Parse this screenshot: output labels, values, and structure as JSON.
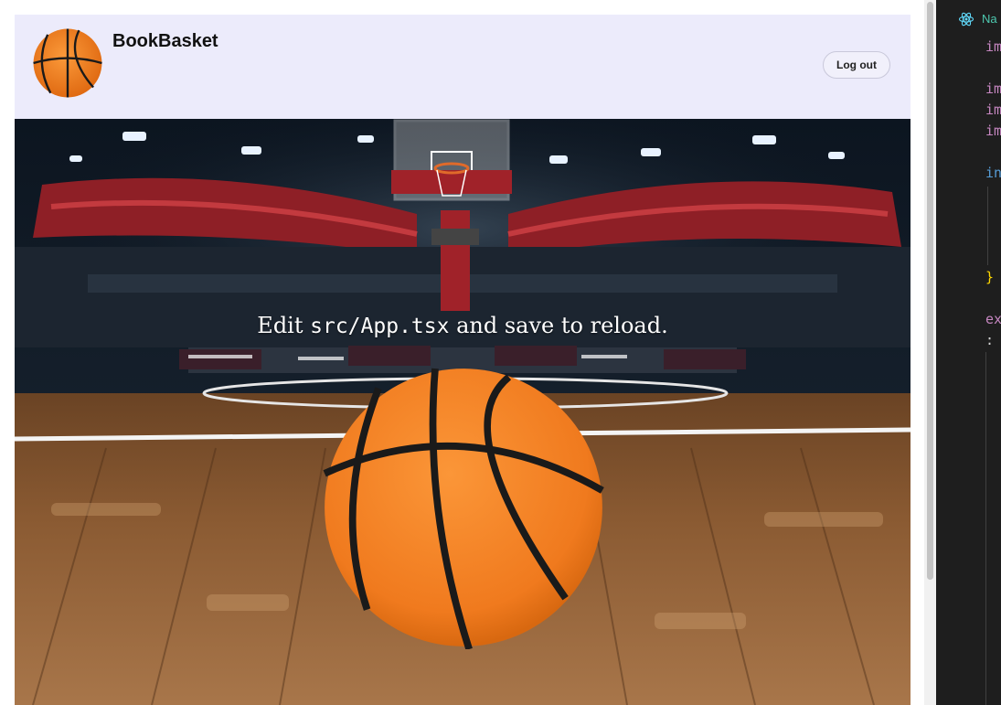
{
  "app": {
    "brand": "BookBasket",
    "logout_label": "Log out",
    "hero_text_prefix": "Edit ",
    "hero_text_code": "src/App.tsx",
    "hero_text_suffix": " and save to reload."
  },
  "icons": {
    "logo": "basketball-icon",
    "hero_ball": "basketball-image",
    "editor_tab": "react-icon"
  },
  "colors": {
    "header_bg": "#ecebfb",
    "ball_orange": "#f47a1f",
    "editor_bg": "#1e1e1e",
    "react_blue": "#61dafb",
    "keyword_purple": "#c586c0",
    "keyword_blue": "#569cd6",
    "brace_yellow": "#ffd700",
    "type_teal": "#4ec9b0"
  },
  "editor": {
    "tab_label": "Na",
    "lines": [
      {
        "text": "im",
        "color": "#c586c0"
      },
      {
        "text": "im",
        "color": "#c586c0"
      },
      {
        "text": "im",
        "color": "#c586c0"
      },
      {
        "text": "im",
        "color": "#c586c0"
      },
      {
        "text": "in",
        "color": "#569cd6"
      },
      {
        "text": "}",
        "color": "#ffd700"
      },
      {
        "text": "ex",
        "color": "#c586c0"
      },
      {
        "text": ":",
        "color": "#d4d4d4"
      }
    ]
  }
}
